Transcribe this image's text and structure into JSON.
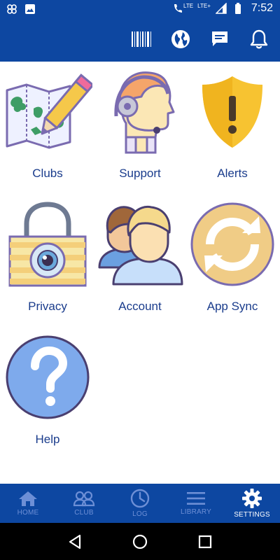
{
  "status_bar": {
    "network_1": "LTE",
    "network_2": "LTE+",
    "time": "7:52"
  },
  "app_bar": {
    "actions": [
      "barcode-icon",
      "globe-icon",
      "chat-icon",
      "bell-icon"
    ]
  },
  "tiles": [
    {
      "label": "Clubs",
      "icon": "map-pencil-icon"
    },
    {
      "label": "Support",
      "icon": "headset-agent-icon"
    },
    {
      "label": "Alerts",
      "icon": "warning-shield-icon"
    },
    {
      "label": "Privacy",
      "icon": "padlock-eye-icon"
    },
    {
      "label": "Account",
      "icon": "users-icon"
    },
    {
      "label": "App Sync",
      "icon": "sync-icon"
    },
    {
      "label": "Help",
      "icon": "question-icon"
    }
  ],
  "bottom_nav": {
    "items": [
      {
        "label": "HOME",
        "icon": "home-icon"
      },
      {
        "label": "CLUB",
        "icon": "group-icon"
      },
      {
        "label": "LOG",
        "icon": "clock-icon"
      },
      {
        "label": "LIBRARY",
        "icon": "list-icon"
      },
      {
        "label": "SETTINGS",
        "icon": "gear-icon"
      }
    ],
    "active": "SETTINGS"
  },
  "colors": {
    "primary": "#0d47a1",
    "label": "#1a3c8c",
    "nav_inactive": "#6d8fd6",
    "nav_active": "#ffffff"
  }
}
